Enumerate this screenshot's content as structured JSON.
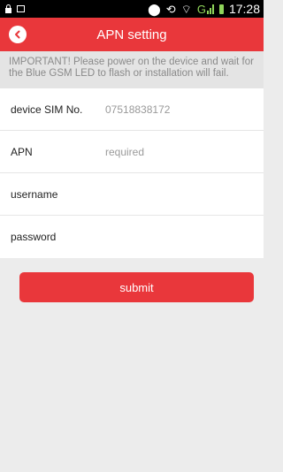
{
  "status_bar": {
    "network": "G",
    "time": "17:28"
  },
  "header": {
    "title": "APN setting"
  },
  "notice": {
    "text": "IMPORTANT! Please power on the device and wait for the Blue GSM LED to flash or installation will fail."
  },
  "form": {
    "fields": [
      {
        "label": "device SIM No.",
        "value": "07518838172",
        "placeholder": ""
      },
      {
        "label": "APN",
        "value": "",
        "placeholder": "required"
      },
      {
        "label": "username",
        "value": "",
        "placeholder": ""
      },
      {
        "label": "password",
        "value": "",
        "placeholder": ""
      }
    ]
  },
  "actions": {
    "submit_label": "submit"
  },
  "colors": {
    "accent": "#e9373b",
    "background": "#ececec",
    "notice_bg": "#e4e4e4"
  }
}
